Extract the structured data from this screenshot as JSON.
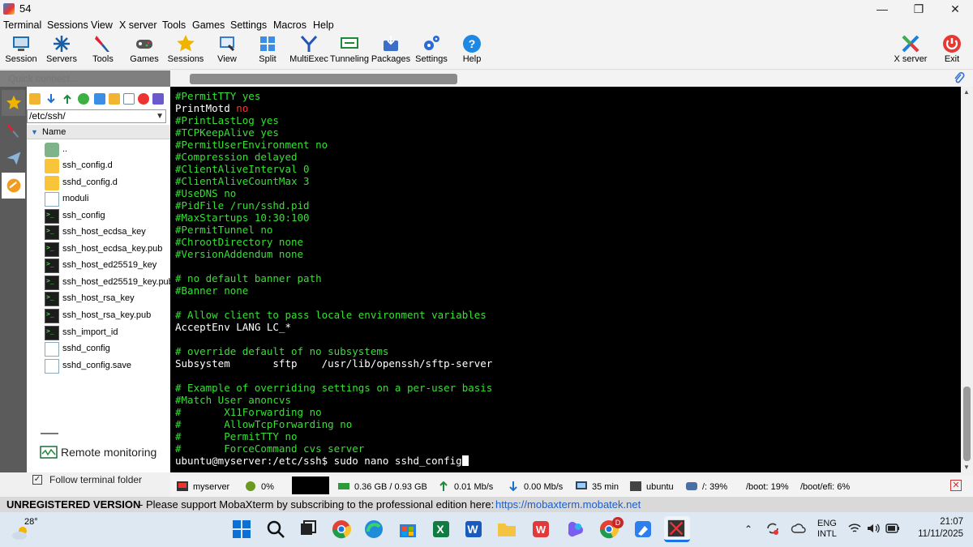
{
  "window": {
    "title": "54",
    "minimize": "—",
    "restore": "❐",
    "close": "✕"
  },
  "menu": [
    "Terminal",
    "Sessions",
    "View",
    "X server",
    "Tools",
    "Games",
    "Settings",
    "Macros",
    "Help"
  ],
  "toolbar": {
    "items": [
      {
        "label": "Session",
        "icon": "session-icon",
        "color": "#1f6fb5"
      },
      {
        "label": "Servers",
        "icon": "servers-icon",
        "color": "#1a5fa3"
      },
      {
        "label": "Tools",
        "icon": "tools-icon",
        "color": "#d23"
      },
      {
        "label": "Games",
        "icon": "games-icon",
        "color": "#555"
      },
      {
        "label": "Sessions",
        "icon": "sessions-star-icon",
        "color": "#f0b400"
      },
      {
        "label": "View",
        "icon": "view-icon",
        "color": "#3a7bd5"
      },
      {
        "label": "Split",
        "icon": "split-icon",
        "color": "#3a8ee6"
      },
      {
        "label": "MultiExec",
        "icon": "multiexec-icon",
        "color": "#2356b8"
      },
      {
        "label": "Tunneling",
        "icon": "tunneling-icon",
        "color": "#1c8a3a"
      },
      {
        "label": "Packages",
        "icon": "packages-icon",
        "color": "#3c6fc8"
      },
      {
        "label": "Settings",
        "icon": "settings-gear-icon",
        "color": "#2c6bd6"
      },
      {
        "label": "Help",
        "icon": "help-icon",
        "color": "#1e88e5"
      }
    ],
    "right": [
      {
        "label": "X server",
        "icon": "x-server-icon"
      },
      {
        "label": "Exit",
        "icon": "exit-power-icon"
      }
    ]
  },
  "quick_connect": {
    "placeholder": "Quick connect..."
  },
  "file_browser": {
    "path": "/etc/ssh/",
    "column": "Name",
    "files": [
      {
        "name": "..",
        "type": "up"
      },
      {
        "name": "ssh_config.d",
        "type": "folder"
      },
      {
        "name": "sshd_config.d",
        "type": "folder"
      },
      {
        "name": "moduli",
        "type": "file"
      },
      {
        "name": "ssh_config",
        "type": "term"
      },
      {
        "name": "ssh_host_ecdsa_key",
        "type": "term"
      },
      {
        "name": "ssh_host_ecdsa_key.pub",
        "type": "term"
      },
      {
        "name": "ssh_host_ed25519_key",
        "type": "term"
      },
      {
        "name": "ssh_host_ed25519_key.pub",
        "type": "term"
      },
      {
        "name": "ssh_host_rsa_key",
        "type": "term"
      },
      {
        "name": "ssh_host_rsa_key.pub",
        "type": "term"
      },
      {
        "name": "ssh_import_id",
        "type": "term"
      },
      {
        "name": "sshd_config",
        "type": "file"
      },
      {
        "name": "sshd_config.save",
        "type": "file"
      }
    ],
    "remote_monitoring": "Remote monitoring",
    "follow_terminal": "Follow terminal folder"
  },
  "terminal": {
    "lines": [
      {
        "text": "#PermitTTY yes",
        "style": "g"
      },
      {
        "text": "PrintMotd",
        "style": "w",
        "tail": " no",
        "tail_style": "r"
      },
      {
        "text": "#PrintLastLog yes",
        "style": "g"
      },
      {
        "text": "#TCPKeepAlive yes",
        "style": "g"
      },
      {
        "text": "#PermitUserEnvironment no",
        "style": "g"
      },
      {
        "text": "#Compression delayed",
        "style": "g"
      },
      {
        "text": "#ClientAliveInterval 0",
        "style": "g"
      },
      {
        "text": "#ClientAliveCountMax 3",
        "style": "g"
      },
      {
        "text": "#UseDNS no",
        "style": "g"
      },
      {
        "text": "#PidFile /run/sshd.pid",
        "style": "g"
      },
      {
        "text": "#MaxStartups 10:30:100",
        "style": "g"
      },
      {
        "text": "#PermitTunnel no",
        "style": "g"
      },
      {
        "text": "#ChrootDirectory none",
        "style": "g"
      },
      {
        "text": "#VersionAddendum none",
        "style": "g"
      },
      {
        "text": "",
        "style": "g"
      },
      {
        "text": "# no default banner path",
        "style": "g"
      },
      {
        "text": "#Banner none",
        "style": "g"
      },
      {
        "text": "",
        "style": "g"
      },
      {
        "text": "# Allow client to pass locale environment variables",
        "style": "g"
      },
      {
        "text": "AcceptEnv LANG LC_*",
        "style": "w"
      },
      {
        "text": "",
        "style": "g"
      },
      {
        "text": "# override default of no subsystems",
        "style": "g"
      },
      {
        "text": "Subsystem       sftp    /usr/lib/openssh/sftp-server",
        "style": "w"
      },
      {
        "text": "",
        "style": "g"
      },
      {
        "text": "# Example of overriding settings on a per-user basis",
        "style": "g"
      },
      {
        "text": "#Match User anoncvs",
        "style": "g"
      },
      {
        "text": "#       X11Forwarding no",
        "style": "g"
      },
      {
        "text": "#       AllowTcpForwarding no",
        "style": "g"
      },
      {
        "text": "#       PermitTTY no",
        "style": "g"
      },
      {
        "text": "#       ForceCommand cvs server",
        "style": "g"
      }
    ],
    "prompt": "ubuntu@myserver:/etc/ssh$ sudo nano sshd_config"
  },
  "status": {
    "server": "myserver",
    "cpu": "0%",
    "memory": "0.36 GB / 0.93 GB",
    "upload": "0.01 Mb/s",
    "download": "0.00 Mb/s",
    "uptime": "35 min",
    "user": "ubuntu",
    "disk_root": "/: 39%",
    "disk_boot": "/boot: 19%",
    "disk_efi": "/boot/efi: 6%"
  },
  "unregistered": {
    "title": "UNREGISTERED VERSION",
    "message": " -  Please support MobaXterm by subscribing to the professional edition here:",
    "link": "https://mobaxterm.mobatek.net"
  },
  "taskbar": {
    "weather": "28°",
    "lang1": "ENG",
    "lang2": "INTL",
    "time": "21:07",
    "date": "11/11/2025",
    "badge": "D"
  },
  "colors": {
    "terminal_green": "#36e034",
    "terminal_bg": "#000000",
    "link": "#1a5fd0"
  }
}
